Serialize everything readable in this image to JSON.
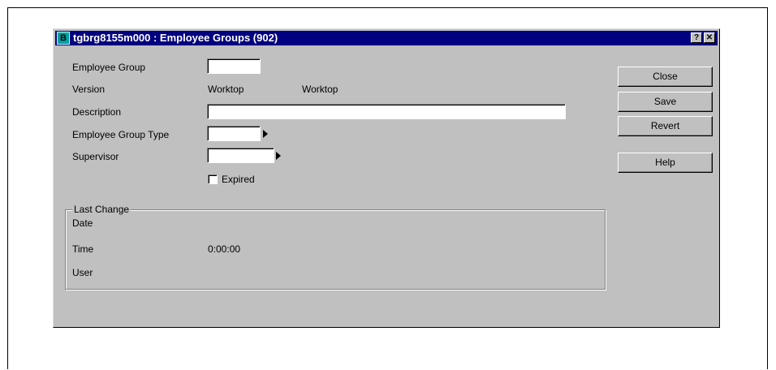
{
  "window": {
    "title": "tgbrg8155m000 : Employee Groups (902)",
    "app_icon_letter": "B",
    "help_glyph": "?",
    "close_glyph": "✕"
  },
  "form": {
    "employee_group_label": "Employee Group",
    "employee_group_value": "",
    "version_label": "Version",
    "version_value_1": "Worktop",
    "version_value_2": "Worktop",
    "description_label": "Description",
    "description_value": "",
    "employee_group_type_label": "Employee Group Type",
    "employee_group_type_value": "",
    "supervisor_label": "Supervisor",
    "supervisor_value": "",
    "expired_label": "Expired",
    "expired_checked": false
  },
  "last_change": {
    "title": "Last Change",
    "date_label": "Date",
    "date_value": "",
    "time_label": "Time",
    "time_value": "0:00:00",
    "user_label": "User",
    "user_value": ""
  },
  "buttons": {
    "close": "Close",
    "save": "Save",
    "revert": "Revert",
    "help": "Help"
  },
  "icons": {
    "app": "baan-app-icon",
    "zoom": "zoom-arrow-icon"
  },
  "colors": {
    "titlebar": "#000080",
    "window_bg": "#c0c0c0"
  }
}
